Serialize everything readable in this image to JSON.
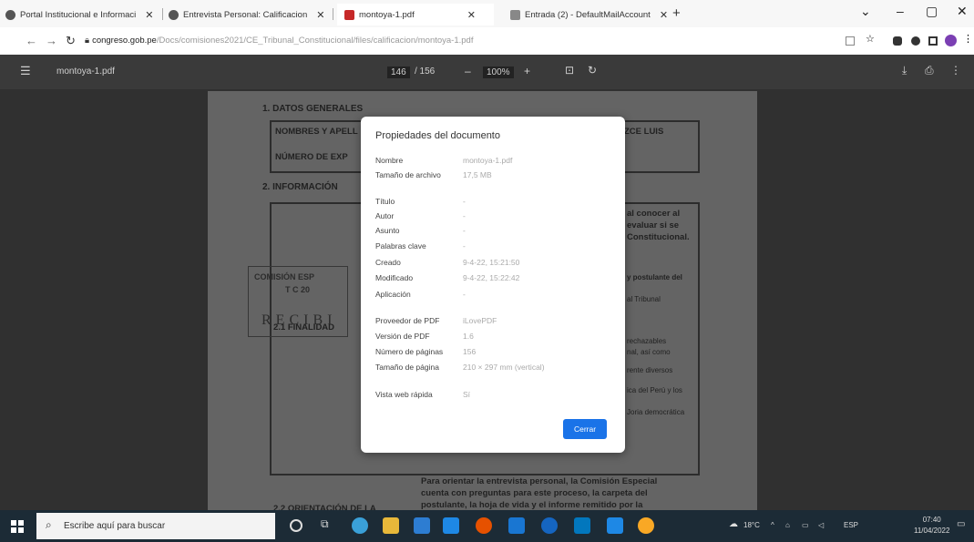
{
  "browser": {
    "tabs": [
      {
        "label": "Portal Institucional e Informaci",
        "icon": "globe-icon"
      },
      {
        "label": "Entrevista Personal: Calificacion",
        "icon": "globe-icon"
      },
      {
        "label": "montoya-1.pdf",
        "icon": "pdf-icon"
      },
      {
        "label": "Entrada (2) - DefaultMailAccount",
        "icon": "mail-icon"
      }
    ],
    "tab_close_glyph": "✕",
    "new_tab_glyph": "+",
    "url_domain": "congreso.gob.pe",
    "url_path": "/Docs/comisiones2021/CE_Tribunal_Constitucional/files/calificacion/montoya-1.pdf"
  },
  "pdf_viewer": {
    "filename": "montoya-1.pdf",
    "page_current": "146",
    "page_total": "/ 156",
    "zoom": "100%"
  },
  "document": {
    "section1": "1.  DATOS GENERALES",
    "row1": "NOMBRES Y APELL",
    "row1_tail": "ZCE LUIS",
    "row2": "NÚMERO DE EXP",
    "section2": "2.  INFORMACIÓN",
    "right_text_1": "al conocer al",
    "right_text_2": "evaluar si se",
    "right_text_3": "Constitucional.",
    "right_text_4": "y postulante del",
    "right_text_5": "al Tribunal",
    "right_text_6": "rechazables",
    "right_text_7": "nal, así como",
    "right_text_8": "rente diversos",
    "right_text_9": "ica del Perú y los",
    "right_text_10": "Joria democrática",
    "finalidad": "2.1 FINALIDAD",
    "stamp_top": "COMISIÓN ESP",
    "stamp_mid": "T C 20",
    "stamp_text": "RECIBI",
    "orientacion": "2.2 ORIENTACIÓN DE LA",
    "para_1": "Para orientar la entrevista personal, la Comisión Especial",
    "para_2": "cuenta con preguntas para este proceso, la carpeta del",
    "para_3": "postulante, la hoja de vida y el informe remitido por la"
  },
  "dialog": {
    "title": "Propiedades del documento",
    "properties": [
      {
        "label": "Nombre",
        "value": "montoya-1.pdf"
      },
      {
        "label": "Tamaño de archivo",
        "value": "17,5 MB"
      },
      {
        "label": "Título",
        "value": "-"
      },
      {
        "label": "Autor",
        "value": "-"
      },
      {
        "label": "Asunto",
        "value": "-"
      },
      {
        "label": "Palabras clave",
        "value": "-"
      },
      {
        "label": "Creado",
        "value": "9-4-22, 15:21:50"
      },
      {
        "label": "Modificado",
        "value": "9-4-22, 15:22:42"
      },
      {
        "label": "Aplicación",
        "value": "-"
      },
      {
        "label": "Proveedor de PDF",
        "value": "iLovePDF"
      },
      {
        "label": "Versión de PDF",
        "value": "1.6"
      },
      {
        "label": "Número de páginas",
        "value": "156"
      },
      {
        "label": "Tamaño de página",
        "value": "210 × 297 mm (vertical)"
      },
      {
        "label": "Vista web rápida",
        "value": "Sí"
      }
    ],
    "close_label": "Cerrar"
  },
  "taskbar": {
    "search_placeholder": "Escribe aquí para buscar",
    "weather": "18°C",
    "language": "ESP",
    "time": "07:40",
    "date": "11/04/2022"
  },
  "colors": {
    "accent": "#1a73e8",
    "taskbar_bg": "#1c2b36",
    "viewer_bg": "#4a4a4a"
  }
}
